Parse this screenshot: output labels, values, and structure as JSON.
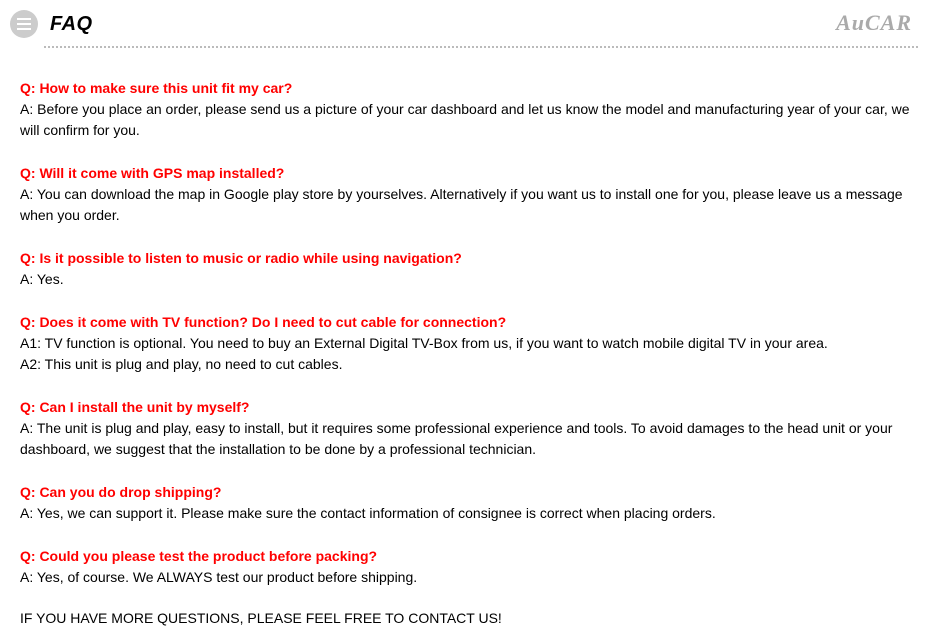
{
  "header": {
    "title": "FAQ",
    "brand": "AuCAR"
  },
  "faqs": [
    {
      "question": "Q: How to make sure this unit fit my car?",
      "answers": [
        "A: Before you place an order, please send us a picture of your car dashboard and let us know the model and manufacturing year of your car, we will confirm for you."
      ]
    },
    {
      "question": "Q: Will it come with GPS map installed?",
      "answers": [
        "A: You can download the map in Google play store by yourselves. Alternatively if you want us to install one for you, please leave us a message when you order."
      ]
    },
    {
      "question": "Q: Is it possible to listen to music or radio while using navigation?",
      "answers": [
        "A: Yes."
      ]
    },
    {
      "question": "Q: Does it come with TV function? Do I need to cut cable for connection?",
      "answers": [
        "A1: TV function is optional. You need to buy an External Digital TV-Box from us, if you want to watch mobile digital TV in your area.",
        "A2: This unit is plug and play, no need to cut cables."
      ]
    },
    {
      "question": "Q: Can I install the unit by myself?",
      "answers": [
        "A: The unit is plug and play, easy to install, but it requires some professional experience and tools. To avoid damages to the head unit or your dashboard, we suggest that the installation to be done by a professional technician."
      ]
    },
    {
      "question": "Q: Can you do drop shipping?",
      "answers": [
        "A: Yes, we can support it. Please make sure the contact information of consignee is correct when placing orders."
      ]
    },
    {
      "question": "Q: Could you please test the product before packing?",
      "answers": [
        "A: Yes, of course. We ALWAYS test our product before shipping."
      ]
    }
  ],
  "footer": "IF YOU HAVE MORE QUESTIONS, PLEASE FEEL FREE TO CONTACT US!"
}
